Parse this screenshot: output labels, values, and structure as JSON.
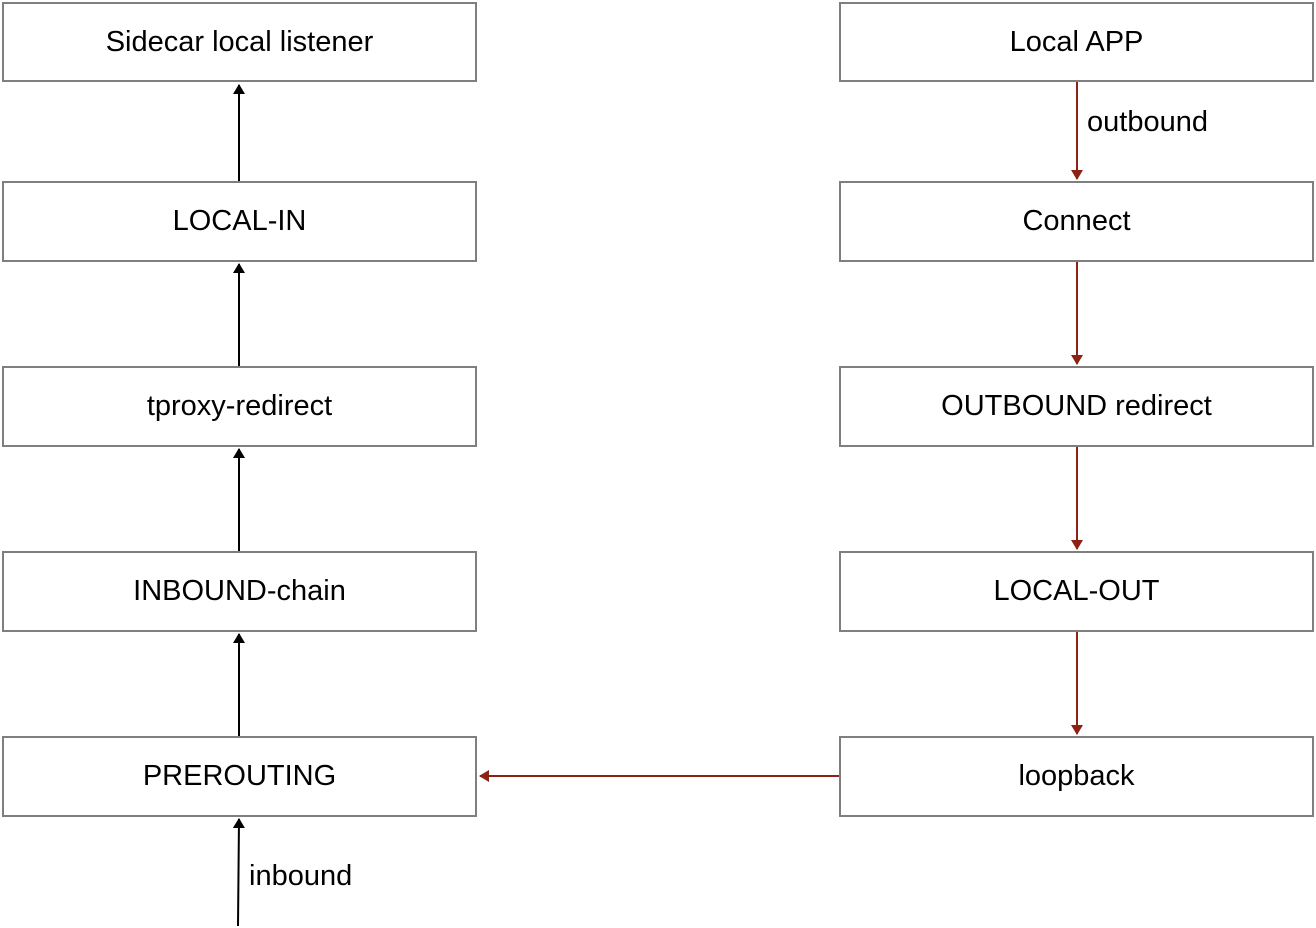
{
  "diagram": {
    "colors": {
      "box_border": "#7f7f7f",
      "inbound_arrow": "#000000",
      "outbound_arrow": "#8b2213"
    },
    "inbound_path": {
      "nodes": [
        {
          "id": "sidecar",
          "label": "Sidecar local listener"
        },
        {
          "id": "local-in",
          "label": "LOCAL-IN"
        },
        {
          "id": "tproxy",
          "label": "tproxy-redirect"
        },
        {
          "id": "inbound-chain",
          "label": "INBOUND-chain"
        },
        {
          "id": "prerouting",
          "label": "PREROUTING"
        }
      ],
      "entry_label": "inbound"
    },
    "outbound_path": {
      "nodes": [
        {
          "id": "local-app",
          "label": "Local APP"
        },
        {
          "id": "connect",
          "label": "Connect"
        },
        {
          "id": "outbound-redirect",
          "label": "OUTBOUND redirect"
        },
        {
          "id": "local-out",
          "label": "LOCAL-OUT"
        },
        {
          "id": "loopback",
          "label": "loopback"
        }
      ],
      "first_edge_label": "outbound"
    },
    "edges": [
      {
        "from": "inbound-entry",
        "to": "prerouting",
        "label": "inbound"
      },
      {
        "from": "prerouting",
        "to": "inbound-chain"
      },
      {
        "from": "inbound-chain",
        "to": "tproxy"
      },
      {
        "from": "tproxy",
        "to": "local-in"
      },
      {
        "from": "local-in",
        "to": "sidecar"
      },
      {
        "from": "local-app",
        "to": "connect",
        "label": "outbound"
      },
      {
        "from": "connect",
        "to": "outbound-redirect"
      },
      {
        "from": "outbound-redirect",
        "to": "local-out"
      },
      {
        "from": "local-out",
        "to": "loopback"
      },
      {
        "from": "loopback",
        "to": "prerouting"
      }
    ]
  }
}
